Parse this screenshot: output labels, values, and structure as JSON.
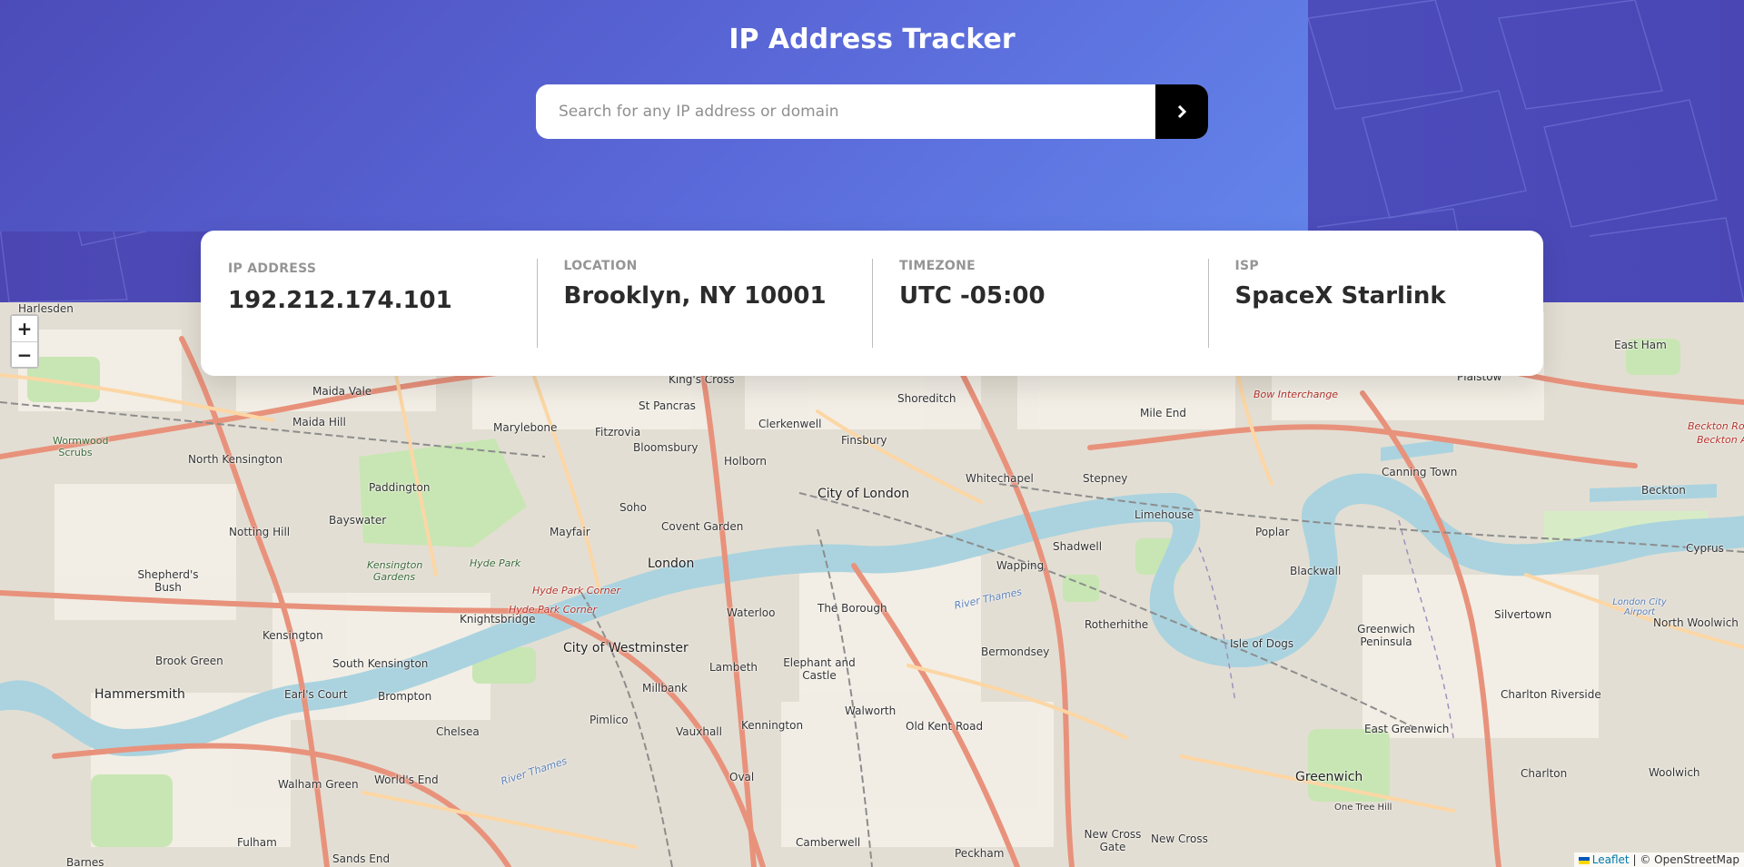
{
  "header": {
    "title": "IP Address Tracker",
    "search_placeholder": "Search for any IP address or domain",
    "search_value": "",
    "submit_icon": "chevron-right-icon"
  },
  "info_card": {
    "items": [
      {
        "label": "IP ADDRESS",
        "value": "192.212.174.101"
      },
      {
        "label": "LOCATION",
        "value": "Brooklyn, NY 10001"
      },
      {
        "label": "TIMEZONE",
        "value": "UTC -05:00"
      },
      {
        "label": "ISP",
        "value": "SpaceX Starlink"
      }
    ]
  },
  "map": {
    "zoom_in": "+",
    "zoom_out": "−",
    "attribution_leaflet": "Leaflet",
    "attribution_separator": "|",
    "attribution_osm": "© OpenStreetMap",
    "labels": {
      "harlesden": "Harlesden",
      "maida_vale": "Maida Vale",
      "maida_hill": "Maida Hill",
      "marylebone": "Marylebone",
      "fitzrovia": "Fitzrovia",
      "kings_cross": "King's Cross",
      "st_pancras": "St Pancras",
      "clerkenwell": "Clerkenwell",
      "shoreditch": "Shoreditch",
      "mile_end": "Mile End",
      "bow_interchange": "Bow Interchange",
      "bloomsbury": "Bloomsbury",
      "finsbury": "Finsbury",
      "holborn": "Holborn",
      "north_kensington": "North Kensington",
      "paddington": "Paddington",
      "wormwood_scrubs": "Wormwood Scrubs",
      "city_of_london": "City of London",
      "whitechapel": "Whitechapel",
      "stepney": "Stepney",
      "limehouse": "Limehouse",
      "poplar": "Poplar",
      "canning_town": "Canning Town",
      "bayswater": "Bayswater",
      "soho": "Soho",
      "covent_garden": "Covent Garden",
      "mayfair": "Mayfair",
      "notting_hill": "Notting Hill",
      "london": "London",
      "shadwell": "Shadwell",
      "wapping": "Wapping",
      "blackwall": "Blackwall",
      "shepherds_bush": "Shepherd's Bush",
      "kensington_gardens": "Kensington Gardens",
      "hyde_park": "Hyde Park",
      "hyde_park_corner": "Hyde Park Corner",
      "knightsbridge": "Knightsbridge",
      "waterloo": "Waterloo",
      "the_borough": "The Borough",
      "rotherhithe": "Rotherhithe",
      "isle_of_dogs": "Isle of Dogs",
      "greenwich_peninsula": "Greenwich Peninsula",
      "silvertown": "Silvertown",
      "north_woolwich": "North Woolwich",
      "kensington": "Kensington",
      "city_of_westminster": "City of Westminster",
      "bermondsey": "Bermondsey",
      "brook_green": "Brook Green",
      "south_kensington": "South Kensington",
      "lambeth": "Lambeth",
      "elephant_and_castle": "Elephant and Castle",
      "hammersmith": "Hammersmith",
      "earls_court": "Earl's Court",
      "brompton": "Brompton",
      "millbank": "Millbank",
      "walworth": "Walworth",
      "old_kent_road": "Old Kent Road",
      "charlton_riverside": "Charlton Riverside",
      "chelsea": "Chelsea",
      "pimlico": "Pimlico",
      "vauxhall": "Vauxhall",
      "kennington": "Kennington",
      "east_greenwich": "East Greenwich",
      "walham_green": "Walham Green",
      "worlds_end": "World's End",
      "oval": "Oval",
      "greenwich": "Greenwich",
      "charlton": "Charlton",
      "woolwich": "Woolwich",
      "fulham": "Fulham",
      "camberwell": "Camberwell",
      "peckham": "Peckham",
      "new_cross_gate": "New Cross Gate",
      "new_cross": "New Cross",
      "east_ham": "East Ham",
      "plaistow": "Plaistow",
      "beckton": "Beckton",
      "cyprus": "Cyprus",
      "barnes": "Barnes",
      "sands_end": "Sands End",
      "one_tree_hill": "One Tree Hill",
      "london_city_airport": "London City Airport",
      "beckton_roundabout": "Beckton Roundabout",
      "beckton_alps": "Beckton Alps",
      "river_thames": "River Thames"
    }
  }
}
